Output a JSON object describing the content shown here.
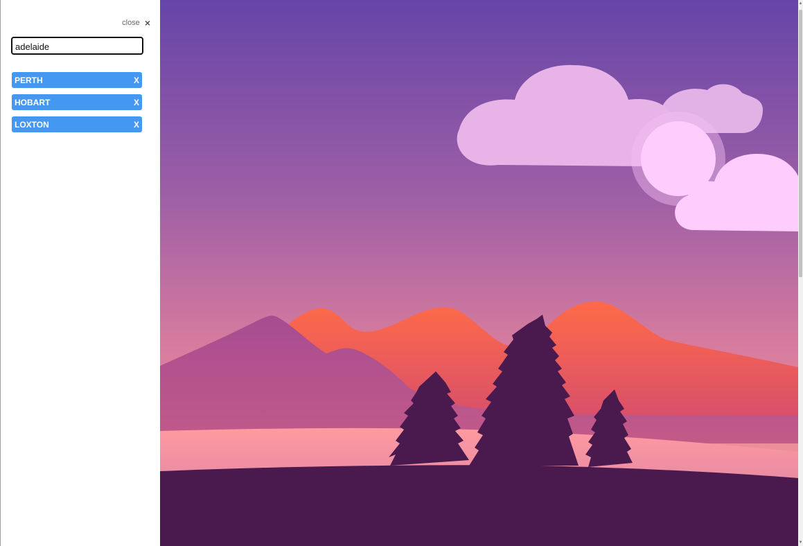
{
  "sidebar": {
    "close_label": "close",
    "close_icon": "×",
    "search": {
      "value": "adelaide",
      "placeholder": ""
    },
    "cities": [
      {
        "name": "PERTH",
        "remove_label": "X"
      },
      {
        "name": "HOBART",
        "remove_label": "X"
      },
      {
        "name": "LOXTON",
        "remove_label": "X"
      }
    ]
  },
  "colors": {
    "city_badge": "#4598f1",
    "sky_top": "#6545a8",
    "sky_bottom": "#f0929a",
    "mountain_orange": "#ff6a48",
    "mountain_purple": "#a74c92",
    "trees": "#4a1a4e",
    "clouds": "#f2c7f2",
    "sun": "#ffd0ff"
  },
  "scrollbar": {
    "up_arrow": "▲",
    "down_arrow": "▼"
  }
}
